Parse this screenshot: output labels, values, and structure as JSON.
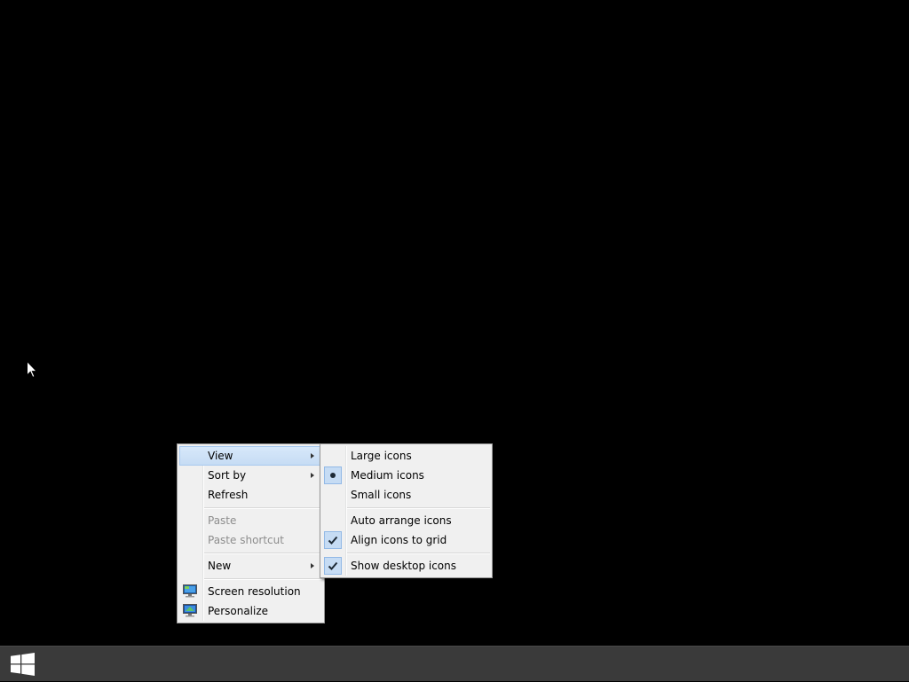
{
  "context_menu": {
    "items": [
      {
        "label": "View",
        "submenu": true,
        "highlighted": true
      },
      {
        "label": "Sort by",
        "submenu": true
      },
      {
        "label": "Refresh"
      },
      {
        "label": "Paste",
        "disabled": true
      },
      {
        "label": "Paste shortcut",
        "disabled": true
      },
      {
        "label": "New",
        "submenu": true
      },
      {
        "label": "Screen resolution",
        "icon": "screen-resolution-icon"
      },
      {
        "label": "Personalize",
        "icon": "personalize-icon"
      }
    ]
  },
  "view_submenu": {
    "items": [
      {
        "label": "Large icons"
      },
      {
        "label": "Medium icons",
        "selected": true,
        "mark": "radio-dot"
      },
      {
        "label": "Small icons"
      },
      {
        "label": "Auto arrange icons"
      },
      {
        "label": "Align icons to grid",
        "checked": true,
        "mark": "check"
      },
      {
        "label": "Show desktop icons",
        "checked": true,
        "mark": "check"
      }
    ]
  },
  "taskbar": {
    "start_icon": "windows-logo-icon"
  },
  "colors": {
    "desktop": "#000000",
    "taskbar": "#3a3a3a",
    "menu_bg": "#f0f0f0",
    "highlight": "#c6dcf4",
    "disabled_text": "#8d8d8d"
  }
}
